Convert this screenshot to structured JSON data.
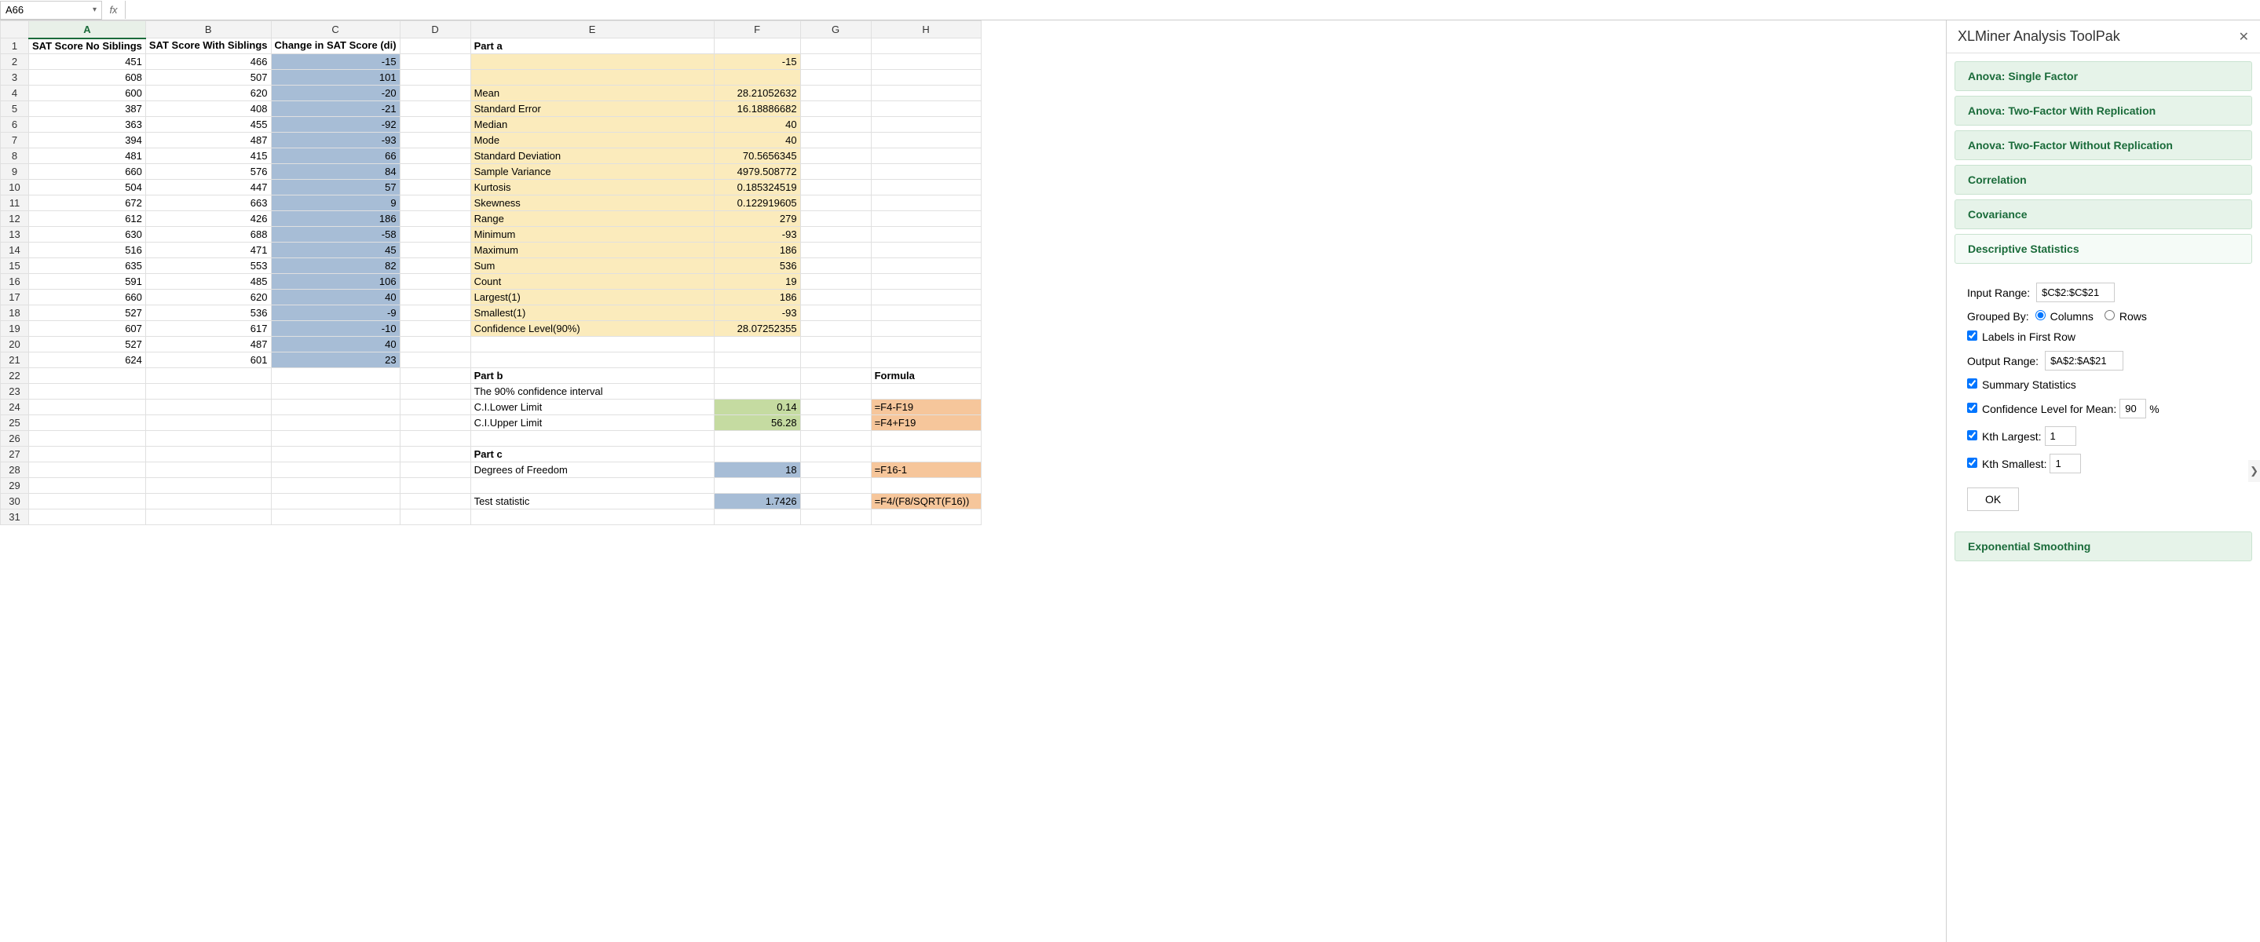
{
  "formulaBar": {
    "cellRef": "A66",
    "value": ""
  },
  "columns": [
    "A",
    "B",
    "C",
    "D",
    "E",
    "F",
    "G",
    "H"
  ],
  "rowCount": 31,
  "headers": {
    "A": "SAT Score   No Siblings",
    "B": "SAT Score With Siblings",
    "C": "Change in SAT Score (di)"
  },
  "dataRows": [
    {
      "A": 451,
      "B": 466,
      "C": -15
    },
    {
      "A": 608,
      "B": 507,
      "C": 101
    },
    {
      "A": 600,
      "B": 620,
      "C": -20
    },
    {
      "A": 387,
      "B": 408,
      "C": -21
    },
    {
      "A": 363,
      "B": 455,
      "C": -92
    },
    {
      "A": 394,
      "B": 487,
      "C": -93
    },
    {
      "A": 481,
      "B": 415,
      "C": 66
    },
    {
      "A": 660,
      "B": 576,
      "C": 84
    },
    {
      "A": 504,
      "B": 447,
      "C": 57
    },
    {
      "A": 672,
      "B": 663,
      "C": 9
    },
    {
      "A": 612,
      "B": 426,
      "C": 186
    },
    {
      "A": 630,
      "B": 688,
      "C": -58
    },
    {
      "A": 516,
      "B": 471,
      "C": 45
    },
    {
      "A": 635,
      "B": 553,
      "C": 82
    },
    {
      "A": 591,
      "B": 485,
      "C": 106
    },
    {
      "A": 660,
      "B": 620,
      "C": 40
    },
    {
      "A": 527,
      "B": 536,
      "C": -9
    },
    {
      "A": 607,
      "B": 617,
      "C": -10
    },
    {
      "A": 527,
      "B": 487,
      "C": 40
    },
    {
      "A": 624,
      "B": 601,
      "C": 23
    }
  ],
  "partA": {
    "title": "Part a",
    "firstVal": -15,
    "stats": [
      {
        "label": "Mean",
        "val": "28.21052632"
      },
      {
        "label": "Standard Error",
        "val": "16.18886682"
      },
      {
        "label": "Median",
        "val": "40"
      },
      {
        "label": "Mode",
        "val": "40"
      },
      {
        "label": "Standard Deviation",
        "val": "70.5656345"
      },
      {
        "label": "Sample Variance",
        "val": "4979.508772"
      },
      {
        "label": "Kurtosis",
        "val": "0.185324519"
      },
      {
        "label": "Skewness",
        "val": "0.122919605"
      },
      {
        "label": "Range",
        "val": "279"
      },
      {
        "label": "Minimum",
        "val": "-93"
      },
      {
        "label": "Maximum",
        "val": "186"
      },
      {
        "label": "Sum",
        "val": "536"
      },
      {
        "label": "Count",
        "val": "19"
      },
      {
        "label": "Largest(1)",
        "val": "186"
      },
      {
        "label": "Smallest(1)",
        "val": "-93"
      },
      {
        "label": "Confidence Level(90%)",
        "val": "28.07252355"
      }
    ]
  },
  "partB": {
    "title": "Part b",
    "subtitle": "The 90% confidence interval",
    "formulaHeader": "Formula",
    "rows": [
      {
        "label": "C.I.Lower Limit",
        "val": "0.14",
        "formula": "=F4-F19"
      },
      {
        "label": "C.I.Upper Limit",
        "val": "56.28",
        "formula": "=F4+F19"
      }
    ]
  },
  "partC": {
    "title": "Part c",
    "rows": [
      {
        "label": "Degrees of Freedom",
        "val": "18",
        "formula": "=F16-1"
      },
      {
        "label": "",
        "val": "",
        "formula": ""
      },
      {
        "label": "Test statistic",
        "val": "1.7426",
        "formula": "=F4/(F8/SQRT(F16))"
      }
    ]
  },
  "panel": {
    "title": "XLMiner Analysis ToolPak",
    "tools": [
      {
        "label": "Anova: Single Factor",
        "active": false
      },
      {
        "label": "Anova: Two-Factor With Replication",
        "active": false
      },
      {
        "label": "Anova: Two-Factor Without Replication",
        "active": false
      },
      {
        "label": "Correlation",
        "active": false
      },
      {
        "label": "Covariance",
        "active": false
      },
      {
        "label": "Descriptive Statistics",
        "active": true
      }
    ],
    "form": {
      "inputRangeLabel": "Input Range:",
      "inputRange": "$C$2:$C$21",
      "groupedByLabel": "Grouped By:",
      "groupedByColumns": "Columns",
      "groupedByRows": "Rows",
      "groupedBySel": "columns",
      "labelsFirstRow": "Labels in First Row",
      "labelsChecked": true,
      "outputRangeLabel": "Output Range:",
      "outputRange": "$A$2:$A$21",
      "summaryStats": "Summary Statistics",
      "summaryChecked": true,
      "confLabel": "Confidence Level for Mean:",
      "confVal": "90",
      "confPct": "%",
      "confChecked": true,
      "kthLargestLabel": "Kth Largest:",
      "kthLargestVal": "1",
      "kthLargestChecked": true,
      "kthSmallestLabel": "Kth Smallest:",
      "kthSmallestVal": "1",
      "kthSmallestChecked": true,
      "ok": "OK"
    },
    "bottomTool": {
      "label": "Exponential Smoothing"
    }
  }
}
